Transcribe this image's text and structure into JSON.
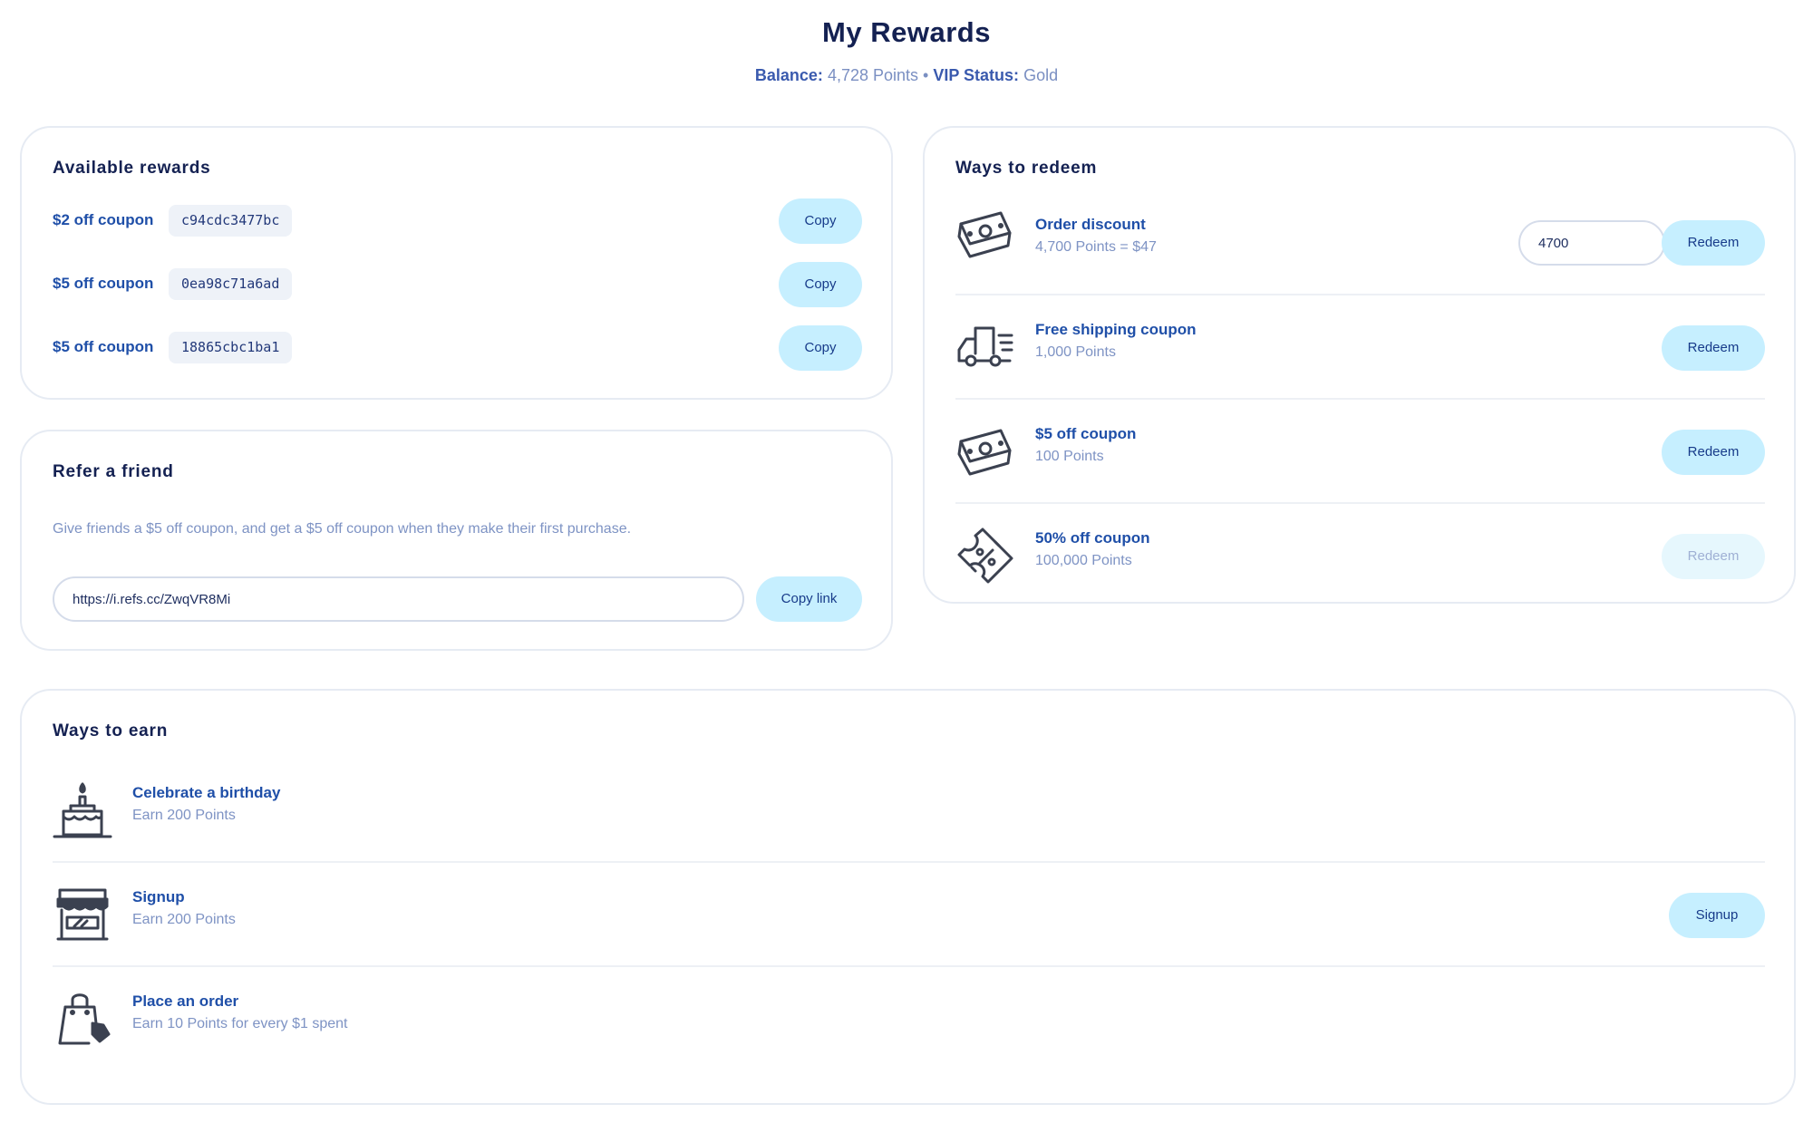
{
  "header": {
    "title": "My Rewards",
    "balance_label": "Balance:",
    "balance_value": "4,728 Points",
    "separator": "•",
    "vip_label": "VIP Status:",
    "vip_value": "Gold"
  },
  "available_rewards": {
    "title": "Available rewards",
    "copy_label": "Copy",
    "items": [
      {
        "name": "$2 off coupon",
        "code": "c94cdc3477bc"
      },
      {
        "name": "$5 off coupon",
        "code": "0ea98c71a6ad"
      },
      {
        "name": "$5 off coupon",
        "code": "18865cbc1ba1"
      }
    ]
  },
  "refer": {
    "title": "Refer a friend",
    "description": "Give friends a $5 off coupon, and get a $5 off coupon when they make their first purchase.",
    "link": "https://i.refs.cc/ZwqVR8Mi",
    "copy_link_label": "Copy link"
  },
  "redeem": {
    "title": "Ways to redeem",
    "redeem_label": "Redeem",
    "items": [
      {
        "title": "Order discount",
        "subtitle": "4,700 Points = $47",
        "input_value": "4700",
        "icon": "money-icon",
        "enabled": true
      },
      {
        "title": "Free shipping coupon",
        "subtitle": "1,000 Points",
        "icon": "truck-icon",
        "enabled": true
      },
      {
        "title": "$5 off coupon",
        "subtitle": "100 Points",
        "icon": "money-icon",
        "enabled": true
      },
      {
        "title": "50% off coupon",
        "subtitle": "100,000 Points",
        "icon": "percent-ticket-icon",
        "enabled": false
      }
    ]
  },
  "earn": {
    "title": "Ways to earn",
    "items": [
      {
        "title": "Celebrate a birthday",
        "subtitle": "Earn 200 Points",
        "icon": "birthday-cake-icon"
      },
      {
        "title": "Signup",
        "subtitle": "Earn 200 Points",
        "icon": "storefront-icon",
        "button_label": "Signup"
      },
      {
        "title": "Place an order",
        "subtitle": "Earn 10 Points for every $1 spent",
        "icon": "shopping-bag-icon"
      }
    ]
  },
  "colors": {
    "title": "#142152",
    "link_blue": "#1f4fa8",
    "muted": "#7e93c4",
    "button_bg": "#c6efff",
    "button_disabled_bg": "#e6f7fd"
  }
}
